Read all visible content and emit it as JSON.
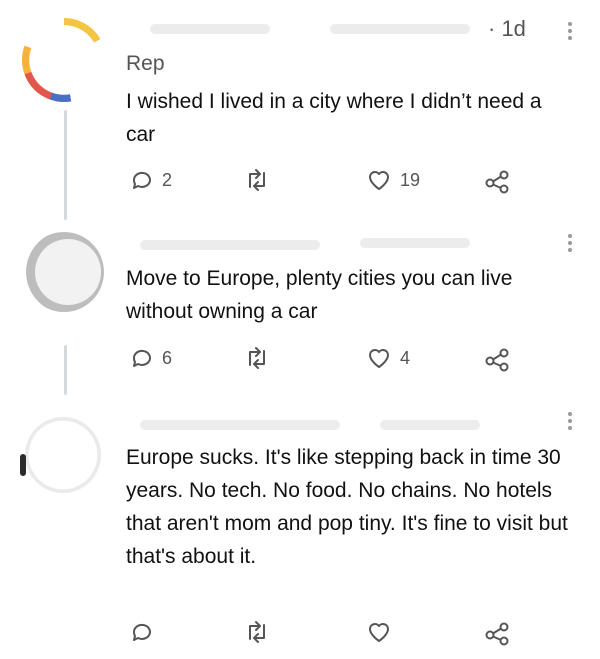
{
  "posts": [
    {
      "handle": "Rep",
      "time": "· 1d",
      "text": "I wished I lived in a city where I didn’t need a car",
      "replies": "2",
      "likes": "19"
    },
    {
      "text": "Move to Europe, plenty cities you can live without owning a car",
      "replies": "6",
      "likes": "4"
    },
    {
      "text": "Europe sucks.  It's like stepping back in time 30 years.  No tech.  No food.  No chains.  No hotels that aren't mom and pop tiny.  It's fine to visit but that's about it.",
      "replies": "",
      "likes": ""
    }
  ],
  "icons": {
    "reply": "reply-icon",
    "retweet": "retweet-icon",
    "like": "heart-icon",
    "share": "share-icon",
    "menu": "more-vertical-icon"
  },
  "colors": {
    "icon": "#555555",
    "thread_line": "#d6d9dc"
  }
}
